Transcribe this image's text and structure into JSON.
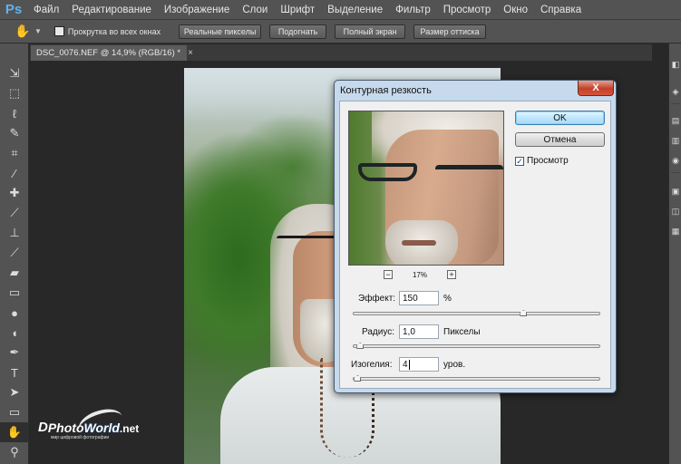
{
  "app": {
    "logo": "Ps"
  },
  "menu": [
    "Файл",
    "Редактирование",
    "Изображение",
    "Слои",
    "Шрифт",
    "Выделение",
    "Фильтр",
    "Просмотр",
    "Окно",
    "Справка"
  ],
  "options": {
    "scroll_all_windows": {
      "label": "Прокрутка во всех окнах",
      "checked": false
    },
    "buttons": [
      "Реальные пикселы",
      "Подогнать",
      "Полный экран",
      "Размер оттиска"
    ]
  },
  "document_tab": {
    "title": "DSC_0076.NEF @ 14,9% (RGB/16) *",
    "close": "×"
  },
  "tools": [
    "move-icon",
    "marquee-icon",
    "lasso-icon",
    "quick-select-icon",
    "crop-icon",
    "eyedropper-icon",
    "healing-icon",
    "brush-icon",
    "stamp-icon",
    "history-brush-icon",
    "eraser-icon",
    "gradient-icon",
    "blur-icon",
    "dodge-icon",
    "pen-icon",
    "type-icon",
    "path-select-icon",
    "shape-icon",
    "hand-icon",
    "zoom-icon"
  ],
  "dialog": {
    "title": "Контурная резкость",
    "close": "X",
    "ok_label": "OK",
    "cancel_label": "Отмена",
    "preview": {
      "label": "Просмотр",
      "checked": true
    },
    "zoom": {
      "minus": "−",
      "plus": "+",
      "value": "17%"
    },
    "amount": {
      "label": "Эффект:",
      "value": "150",
      "unit": "%",
      "level": 0.69
    },
    "radius": {
      "label": "Радиус:",
      "value": "1,0",
      "unit": "Пикселы",
      "level": 0.03
    },
    "threshold": {
      "label": "Изогелия:",
      "value": "4",
      "unit": "уров.",
      "level": 0.02
    }
  },
  "watermark": {
    "d": "D",
    "photo": "Photo",
    "world": "World",
    "net": ".net",
    "sub": "мир цифровой фотографии"
  },
  "colors": {
    "ui_dark": "#535353",
    "dialog_frame": "#c7d9ec",
    "ps_blue": "#5fb3ee"
  }
}
